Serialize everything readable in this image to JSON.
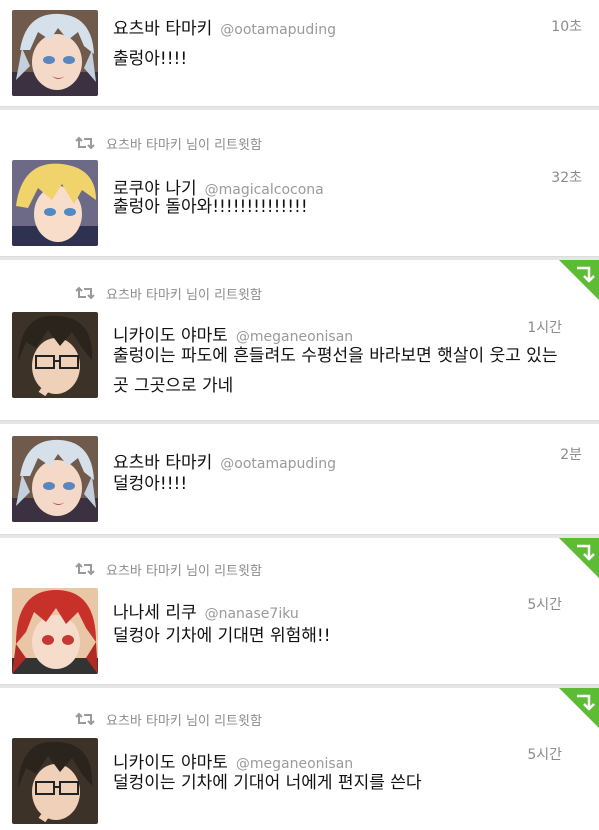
{
  "tweets": [
    {
      "name": "요츠바 타마키",
      "handle": "@ootamapuding",
      "time": "10초",
      "text": "출렁아!!!!",
      "retweet_label": "",
      "favorited": false
    },
    {
      "name": "로쿠야 나기",
      "handle": "@magicalcocona",
      "time": "32초",
      "text": "출렁아 돌아와!!!!!!!!!!!!!!",
      "retweet_label": "요츠바 타마키 님이 리트윗함",
      "favorited": false
    },
    {
      "name": "니카이도 야마토",
      "handle": "@meganeonisan",
      "time": "1시간",
      "text": "출렁이는 파도에 흔들려도 수평선을 바라보면 햇살이 웃고 있는 곳 그곳으로 가네",
      "retweet_label": "요츠바 타마키 님이 리트윗함",
      "favorited": true
    },
    {
      "name": "요츠바 타마키",
      "handle": "@ootamapuding",
      "time": "2분",
      "text": "덜컹아!!!!",
      "retweet_label": "",
      "favorited": false
    },
    {
      "name": "나나세 리쿠",
      "handle": "@nanase7iku",
      "time": "5시간",
      "text": "덜컹아 기차에 기대면 위험해!!",
      "retweet_label": "요츠바 타마키 님이 리트윗함",
      "favorited": true
    },
    {
      "name": "니카이도 야마토",
      "handle": "@meganeonisan",
      "time": "5시간",
      "text": "덜컹이는 기차에 기대어 너에게 편지를 쓴다",
      "retweet_label": "요츠바 타마키 님이 리트윗함",
      "favorited": true
    }
  ],
  "colors": {
    "corner_green": "#5cbc33",
    "retweet_gray": "#9a9a9a",
    "separator": "#e6e6e6"
  },
  "icons": {
    "retweet": "retweet-icon",
    "corner": "favorite-corner-icon",
    "avatar_tamaki": "avatar-silver-hair",
    "avatar_nagi": "avatar-blond-hair",
    "avatar_yamato": "avatar-dark-hair-glasses",
    "avatar_riku": "avatar-red-hair"
  }
}
